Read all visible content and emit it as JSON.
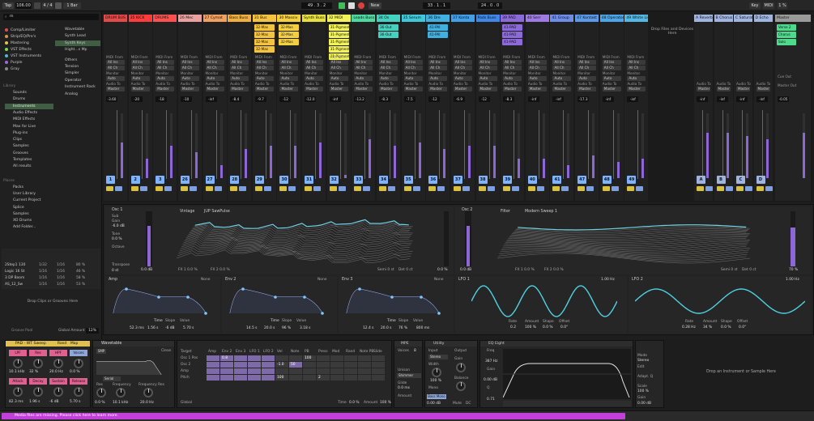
{
  "transport": {
    "tap": "Tap",
    "tempo": "106.00",
    "sig": "4 / 4",
    "bar": "1 Bar",
    "pos": "49 . 3 . 2",
    "new": "New",
    "loop_start": "33 . 1 . 1",
    "loop_len": "24 . 0 . 0",
    "key": "Key",
    "midi": "MIDI",
    "pct": "1 %"
  },
  "browser": {
    "search": "m",
    "collections": [
      {
        "label": "Comp/Limiter",
        "color": "#d94f4f"
      },
      {
        "label": "Strip/EQ/Pre's",
        "color": "#d9914f"
      },
      {
        "label": "Mastering",
        "color": "#d9c84f"
      },
      {
        "label": "VST Effects",
        "color": "#7bd94f"
      },
      {
        "label": "VST Instruments",
        "color": "#4fb4d9"
      },
      {
        "label": "Purple",
        "color": "#9b6bd9"
      },
      {
        "label": "Gray",
        "color": "#888888"
      }
    ],
    "library_header": "Library",
    "categories": [
      "Sounds",
      "Drums",
      "Instruments",
      "Audio Effects",
      "MIDI Effects",
      "Max for Live",
      "Plug-ins",
      "Clips",
      "Samples",
      "Grooves",
      "Templates",
      "All results"
    ],
    "places_header": "Places",
    "places": [
      "Packs",
      "User Library",
      "Current Project",
      "Splice",
      "Samples",
      "XO Drums",
      "Add Folder..."
    ],
    "content": [
      "Wavetable",
      "Synth Lead",
      "Synth Keys",
      "Hight...s Mp",
      "Others",
      "Tension",
      "Simpler",
      "Operator",
      "Instrument Rack",
      "Analog"
    ],
    "session_rows": [
      {
        "name": "2Step1 130",
        "a": "1/32",
        "b": "1/16",
        "c": "80 %"
      },
      {
        "name": "Logic 16 St",
        "a": "1/16",
        "b": "1/16",
        "c": "46 %"
      },
      {
        "name": "3 DP Boom",
        "a": "1/16",
        "b": "1/16",
        "c": "58 %"
      },
      {
        "name": "AS_12_Sw",
        "a": "1/16",
        "b": "1/16",
        "c": "53 %"
      }
    ],
    "drop_hint": "Drop Clips or Grooves Here",
    "groove_label": "Groove Pool",
    "global_amount_label": "Global Amount",
    "global_amount": "12%"
  },
  "tracks": [
    {
      "name": "DRUM BUS",
      "color": "#e34a4a",
      "vol": "-3.60",
      "num": "1",
      "clips": []
    },
    {
      "name": "35 KICK",
      "color": "#ff3b3b",
      "vol": "-20",
      "num": "2",
      "clips": []
    },
    {
      "name": "DRUMS",
      "color": "#ff5050",
      "vol": "-18",
      "num": "3",
      "clips": []
    },
    {
      "name": "26 Mec",
      "color": "#e9a0a0",
      "vol": "-10",
      "num": "26",
      "clips": []
    },
    {
      "name": "27 Cymat",
      "color": "#f0a060",
      "vol": "-inf",
      "num": "27",
      "clips": []
    },
    {
      "name": "Bass Buss",
      "color": "#f0b040",
      "vol": "-8.4",
      "num": "28",
      "clips": []
    },
    {
      "name": "31 Bus",
      "color": "#f4c340",
      "vol": "-9.7",
      "num": "29",
      "clips": [
        "32-Mas",
        "32-Mas",
        "32-Mas",
        "32-Mas"
      ]
    },
    {
      "name": "30 Massiv",
      "color": "#f4d040",
      "vol": "-12",
      "num": "30",
      "clips": [
        "32-Mas",
        "32-Mas",
        "32-Mas"
      ]
    },
    {
      "name": "Synth Buss",
      "color": "#e8e040",
      "vol": "-12.0",
      "num": "31",
      "clips": []
    },
    {
      "name": "32 MIDI",
      "color": "#f2f25a",
      "vol": "-inf",
      "num": "32",
      "clips": [
        "31-Pigments 9",
        "31-Pigments 9",
        "31-Pigments 9",
        "31-Pigments 9",
        "31-Pigments 9"
      ]
    },
    {
      "name": "Leads Buss",
      "color": "#4fd9a0",
      "vol": "-13.2",
      "num": "33",
      "clips": []
    },
    {
      "name": "34 Os",
      "color": "#45d0c0",
      "vol": "-8.3",
      "num": "34",
      "clips": [
        "36-Out",
        "36-Out"
      ]
    },
    {
      "name": "35 Serum",
      "color": "#40c8d8",
      "vol": "-7.5",
      "num": "35",
      "clips": []
    },
    {
      "name": "36 Dre",
      "color": "#40b0e0",
      "vol": "-12",
      "num": "36",
      "clips": [
        "41-PAI",
        "41-PAI"
      ]
    },
    {
      "name": "37 Konta",
      "color": "#40a0e8",
      "vol": "-6.9",
      "num": "37",
      "clips": []
    },
    {
      "name": "Pads Buss",
      "color": "#3f88e8",
      "vol": "-12",
      "num": "38",
      "clips": []
    },
    {
      "name": "39 PAD",
      "color": "#8c6ad9",
      "vol": "-8.3",
      "num": "39",
      "clips": [
        "41-PAD",
        "41-PAD",
        "41-PAD"
      ]
    },
    {
      "name": "40 Serr",
      "color": "#9f7ae6",
      "vol": "-inf",
      "num": "40",
      "clips": []
    },
    {
      "name": "41 Group",
      "color": "#6d8de6",
      "vol": "-inf",
      "num": "41",
      "clips": []
    },
    {
      "name": "47 Kontakt",
      "color": "#5a9ae8",
      "vol": "-17.3",
      "num": "47",
      "clips": []
    },
    {
      "name": "48 Operator",
      "color": "#4aa6e8",
      "vol": "-inf",
      "num": "48",
      "clips": []
    },
    {
      "name": "49 White Light",
      "color": "#54b8e4",
      "vol": "-inf",
      "num": "49",
      "clips": []
    }
  ],
  "returns": [
    {
      "name": "A Reverb",
      "color": "#a0b4e0",
      "vol": "-inf",
      "num": "A"
    },
    {
      "name": "B Chorus",
      "color": "#a0b4e0",
      "vol": "-inf",
      "num": "B"
    },
    {
      "name": "C Saturat",
      "color": "#a0b4e0",
      "vol": "-inf",
      "num": "C"
    },
    {
      "name": "D Echo",
      "color": "#a0b4e0",
      "vol": "-inf",
      "num": "D"
    }
  ],
  "master": {
    "name": "Master",
    "vol": "-0.05",
    "scenes": [
      "Verse 2",
      "Chorus",
      "Solo"
    ]
  },
  "routing": {
    "midi_from": "MIDI From",
    "audio_from": "Audio From",
    "all_ins": "All Ins",
    "all_ch": "All Ch",
    "monitor": "Monitor",
    "in": "In",
    "auto": "Auto",
    "off": "Off",
    "audio_to": "Audio To",
    "master": "Master",
    "sends": "Sends",
    "cue_out": "Cue Out",
    "master_out": "Master Out",
    "drop_hint": "Drop Files and Devices Here"
  },
  "wavetable": {
    "osc1_title": "Osc 1",
    "osc1_wave": "Vintage",
    "osc1_preset": "JUP SawPulse",
    "osc2_title": "Osc 2",
    "osc2_wave": "Filter",
    "osc2_preset": "Modern Sweep 1",
    "gain": "Gain",
    "gain_val": "-6.0 dB",
    "tone": "Tone",
    "tone_val": "0.0 %",
    "octave": "Octave",
    "transpose": "Transpose",
    "transpose_val": "0 st",
    "sub": "Sub",
    "osc1_db": "0.0 dB",
    "osc1_fx1": "FX 1 0.0 %",
    "osc1_fx2": "FX 2 0.0 %",
    "osc1_semi": "Semi 0 st",
    "osc1_det": "Det 0 ct",
    "osc1_pct": "0.0 %",
    "osc2_db": "0.0 dB",
    "osc2_fx1": "FX 1 0.0 %",
    "osc2_fx2": "FX 2 0.0 %",
    "osc2_semi": "Semi 0 st",
    "osc2_det": "Det 0 ct",
    "osc2_pct": "70 %",
    "amp": "Amp",
    "env2": "Env 2",
    "env3": "Env 3",
    "none": "None",
    "time": "Time",
    "slope": "Slope",
    "value": "Value",
    "amp_a": "52.3 ms",
    "amp_d": "1.56 s",
    "amp_s": "-6 dB",
    "amp_r": "5.70 s",
    "env2_a": "14.5 s",
    "env2_d": "20.0 s",
    "env2_s": "96 %",
    "env2_r": "3.18 s",
    "env3_a": "12.4 s",
    "env3_d": "20.0 s",
    "env3_s": "76 %",
    "env3_r": "800 ms",
    "lfo1": "LFO 1",
    "lfo2": "LFO 2",
    "lfo1_rate_l": "Rate",
    "lfo1_amount_l": "Amount",
    "lfo1_shape_l": "Shape",
    "lfo1_offset_l": "Offset",
    "lfo1_rate": "0.2",
    "lfo1_amount": "100 %",
    "lfo1_shape": "0.0 %",
    "lfo1_offset": "0.0°",
    "lfo1_hz": "1.00 Hz",
    "lfo2_rate": "0.28 Hz",
    "lfo2_amount": "34 %",
    "lfo2_shape": "0.0 %",
    "lfo2_offset": "0.0°",
    "lfo2_hz": "1.00 Hz"
  },
  "bottom": {
    "rack_name": "PAD - WT Sweep",
    "rack_btns": [
      "Rand",
      "Map"
    ],
    "macro_btns": [
      "LPF",
      "Res",
      "HPF",
      "Voices Detune"
    ],
    "macro_vals": [
      "10.1 kHz",
      "32 %",
      "20.0 Hz",
      "0.0 %"
    ],
    "macro2": [
      "Attack",
      "Decay",
      "Sustain",
      "Release"
    ],
    "macro2_vals": [
      "82.3 ms",
      "1.96 s",
      "-6 dB",
      "5.70 s"
    ],
    "wt_title": "Wavetable",
    "filter_type": "SMP",
    "filter_mode": "Serial",
    "clean": "Clean",
    "res": "Res",
    "frequency": "Frequency",
    "frequency_res": "Frequency Res",
    "f1_val": "10.1 kHz",
    "f2_val": "20.0 Hz",
    "res_val": "0.0 %",
    "matrix_target": "Target",
    "matrix_cols": [
      "Amp",
      "Env 2",
      "Env 3",
      "LFO 1",
      "LFO 2",
      "Vel",
      "Note",
      "PB",
      "Press",
      "Mod",
      "Rand",
      "Note PB",
      "Slide"
    ],
    "matrix_rows": [
      "Osc 1 Pos",
      "Osc 2",
      "Amp",
      "Pitch"
    ],
    "matrix_vals": [
      "100",
      "50",
      "0.8",
      "-1.0",
      "2",
      "100"
    ],
    "global": "Global",
    "time_l": "Time",
    "time_v": "0.0 %",
    "amount_l": "Amount",
    "amount_v": "100 %",
    "mpe_title": "MPE",
    "voices": "Voices",
    "voices_val": "8",
    "unison": "Unison",
    "unison_mode": "Shimmer",
    "glide": "Glide",
    "glide_val": "0.0 ms",
    "amount": "Amount",
    "utility_title": "Utility",
    "input": "Input",
    "output": "Output",
    "stereo": "Stereo",
    "width": "Width",
    "width_val": "100 %",
    "mono": "Mono",
    "bass_mono": "Bass Mono",
    "gain": "Gain",
    "balance": "Balance",
    "gain_val": "0.00 dB",
    "mute": "Mute",
    "dc": "DC",
    "eq_title": "EQ Eight",
    "eq_freq": "Freq",
    "eq_freq_val": "387 Hz",
    "eq_gain": "Gain",
    "eq_gain_val": "0.00 dB",
    "eq_q": "Q",
    "eq_q_val": "0.71",
    "eq_mode": "Mode",
    "eq_mode_val": "Stereo",
    "eq_edit": "Edit",
    "eq_adapt": "Adapt. Q",
    "eq_scale": "Scale",
    "eq_scale_val": "100 %",
    "eq_gain2": "Gain",
    "eq_gain2_val": "0.00 dB",
    "inst_drop": "Drop an Instrument or Sample Here",
    "preset_name": "39-PAD - WT Sweep"
  },
  "status": {
    "message": "Media files are missing. Please click here to learn more."
  }
}
